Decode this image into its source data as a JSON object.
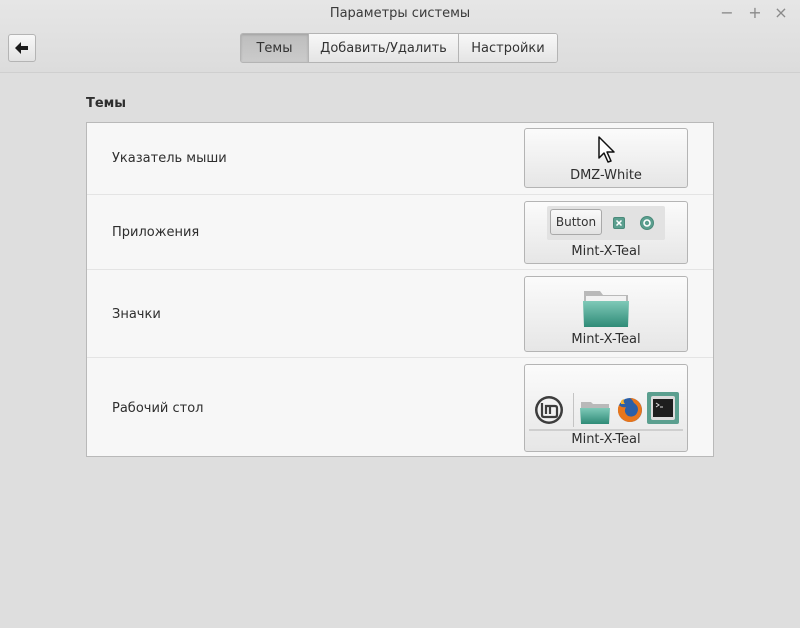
{
  "window": {
    "title": "Параметры системы",
    "controls": {
      "minimize": "−",
      "maximize": "+",
      "close": "×"
    }
  },
  "toolbar": {
    "back_icon": "arrow-left-icon",
    "tabs": [
      {
        "label": "Темы",
        "active": true
      },
      {
        "label": "Добавить/Удалить",
        "active": false
      },
      {
        "label": "Настройки",
        "active": false
      }
    ]
  },
  "themes": {
    "section_title": "Темы",
    "rows": [
      {
        "label": "Указатель мыши",
        "value": "DMZ-White",
        "preview": "cursor-arrow-icon"
      },
      {
        "label": "Приложения",
        "value": "Mint-X-Teal",
        "preview_button": "Button"
      },
      {
        "label": "Значки",
        "value": "Mint-X-Teal",
        "preview": "folder-icon"
      },
      {
        "label": "Рабочий стол",
        "value": "Mint-X-Teal",
        "preview": "desktop-panel"
      }
    ]
  },
  "colors": {
    "accent": "#5b9f8f",
    "folder": "#4fa795"
  }
}
